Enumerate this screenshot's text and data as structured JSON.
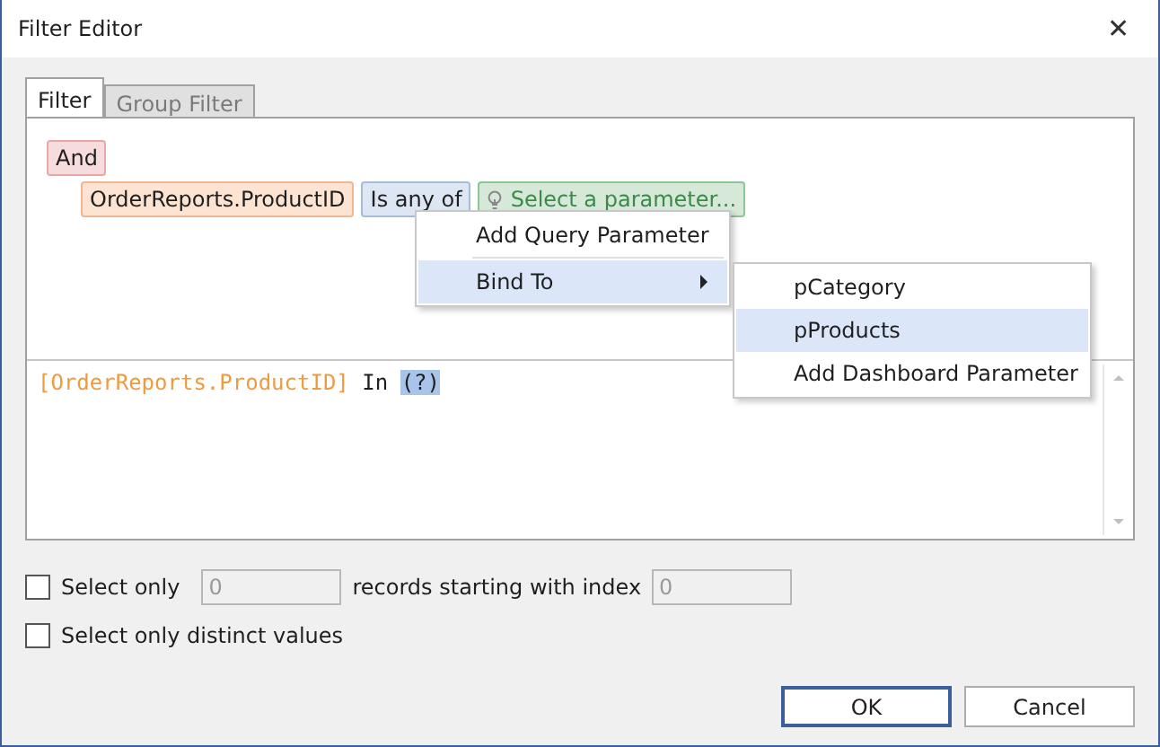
{
  "window": {
    "title": "Filter Editor",
    "close": "✕"
  },
  "tabs": [
    {
      "label": "Filter",
      "selected": true
    },
    {
      "label": "Group Filter",
      "selected": false
    }
  ],
  "criteria": {
    "group": "And",
    "field": "OrderReports.ProductID",
    "operator": "Is any of",
    "value": "Select a parameter..."
  },
  "menu": {
    "items": [
      {
        "label": "Add Query Parameter",
        "highlighted": false,
        "submenu": false
      },
      {
        "label": "Bind To",
        "highlighted": true,
        "submenu": true
      }
    ],
    "submenu": [
      {
        "label": "pCategory",
        "highlighted": false
      },
      {
        "label": "pProducts",
        "highlighted": true
      },
      {
        "label": "Add Dashboard Parameter",
        "highlighted": false
      }
    ]
  },
  "expression": [
    {
      "kind": "field",
      "text": "[OrderReports.ProductID]"
    },
    {
      "kind": "keyword",
      "text": "In"
    },
    {
      "kind": "param",
      "text": "(?)"
    }
  ],
  "options": {
    "select_only": {
      "label": "Select only",
      "checked": false,
      "value": "0",
      "disabled": true
    },
    "starting_label": "records starting with index",
    "start_index": {
      "value": "0",
      "disabled": true
    },
    "distinct": {
      "label": "Select only distinct values",
      "checked": false
    }
  },
  "buttons": [
    {
      "label": "OK",
      "default": true
    },
    {
      "label": "Cancel",
      "default": false
    }
  ]
}
